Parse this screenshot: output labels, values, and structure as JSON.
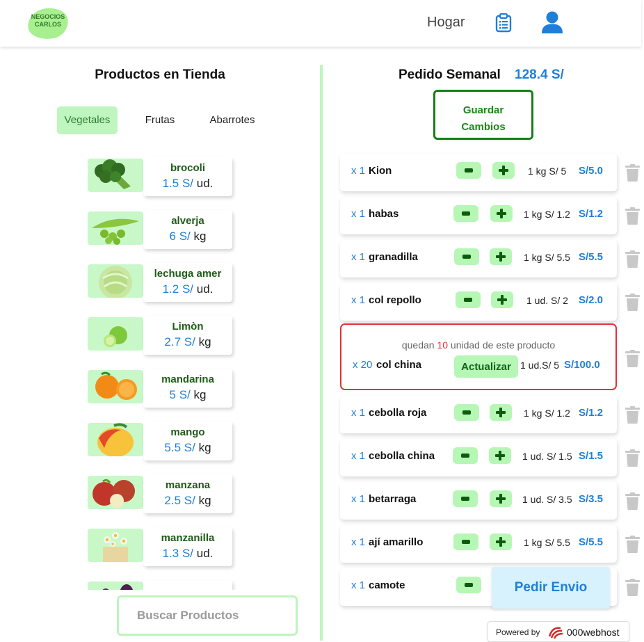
{
  "header": {
    "logo_text": "NEGOCIOS CARLOS",
    "nav_home": "Hogar",
    "icons": [
      "clipboard-icon",
      "user-icon"
    ]
  },
  "store": {
    "title": "Productos en Tienda",
    "tabs": [
      {
        "label": "Vegetales",
        "active": true
      },
      {
        "label": "Frutas",
        "active": false
      },
      {
        "label": "Abarrotes",
        "active": false
      }
    ],
    "products": [
      {
        "name": "brocoli",
        "price": "1.5",
        "currency": "S/",
        "unit": "ud.",
        "image": "broccoli"
      },
      {
        "name": "alverja",
        "price": "6",
        "currency": "S/",
        "unit": "kg",
        "image": "peas"
      },
      {
        "name": "lechuga amer",
        "price": "1.2",
        "currency": "S/",
        "unit": "ud.",
        "image": "lettuce"
      },
      {
        "name": "Limòn",
        "price": "2.7",
        "currency": "S/",
        "unit": "kg",
        "image": "lime"
      },
      {
        "name": "mandarina",
        "price": "5",
        "currency": "S/",
        "unit": "kg",
        "image": "mandarin"
      },
      {
        "name": "mango",
        "price": "5.5",
        "currency": "S/",
        "unit": "kg",
        "image": "mango"
      },
      {
        "name": "manzana",
        "price": "2.5",
        "currency": "S/",
        "unit": "kg",
        "image": "apple"
      },
      {
        "name": "manzanilla",
        "price": "1.3",
        "currency": "S/",
        "unit": "ud.",
        "image": "chamomile"
      }
    ],
    "search_placeholder": "Buscar Productos"
  },
  "order": {
    "title": "Pedido Semanal",
    "total": "128.4 S/",
    "save_label_line1": "Guardar",
    "save_label_line2": "Cambios",
    "items": [
      {
        "qty": "x 1",
        "name": "Kion",
        "unit": "1 kg  S/ 5",
        "total": "S/5.0"
      },
      {
        "qty": "x 1",
        "name": "habas",
        "unit": "1 kg S/ 1.2",
        "total": "S/1.2"
      },
      {
        "qty": "x 1",
        "name": "granadilla",
        "unit": "1 kg S/ 5.5",
        "total": "S/5.5"
      },
      {
        "qty": "x 1",
        "name": "col repollo",
        "unit": "1 ud.  S/ 2",
        "total": "S/2.0"
      },
      {
        "qty": "x 20",
        "name": "col china",
        "unit": "1 ud.S/ 5",
        "total": "S/100.0",
        "editing": true
      },
      {
        "qty": "x 1",
        "name": "cebolla roja",
        "unit": "1 kg S/ 1.2",
        "total": "S/1.2"
      },
      {
        "qty": "x 1",
        "name": "cebolla china",
        "unit": "1 ud. S/ 1.5",
        "total": "S/1.5"
      },
      {
        "qty": "x 1",
        "name": "betarraga",
        "unit": "1 ud. S/ 3.5",
        "total": "S/3.5"
      },
      {
        "qty": "x 1",
        "name": "ají amarillo",
        "unit": "1 kg S/ 5.5",
        "total": "S/5.5"
      },
      {
        "qty": "x 1",
        "name": "camote",
        "unit": "",
        "total": ""
      }
    ],
    "stock_message_prefix": "quedan",
    "stock_left": "10",
    "stock_message_suffix": "unidad de este producto",
    "update_label": "Actualizar",
    "send_label": "Pedir Envio"
  },
  "footer": {
    "powered_by": "Powered by",
    "host": "000webhost"
  },
  "colors": {
    "accent_green": "#bff6bf",
    "dark_green": "#157e15",
    "price_blue": "#1f7fd8",
    "alert_red": "#e4303a"
  }
}
